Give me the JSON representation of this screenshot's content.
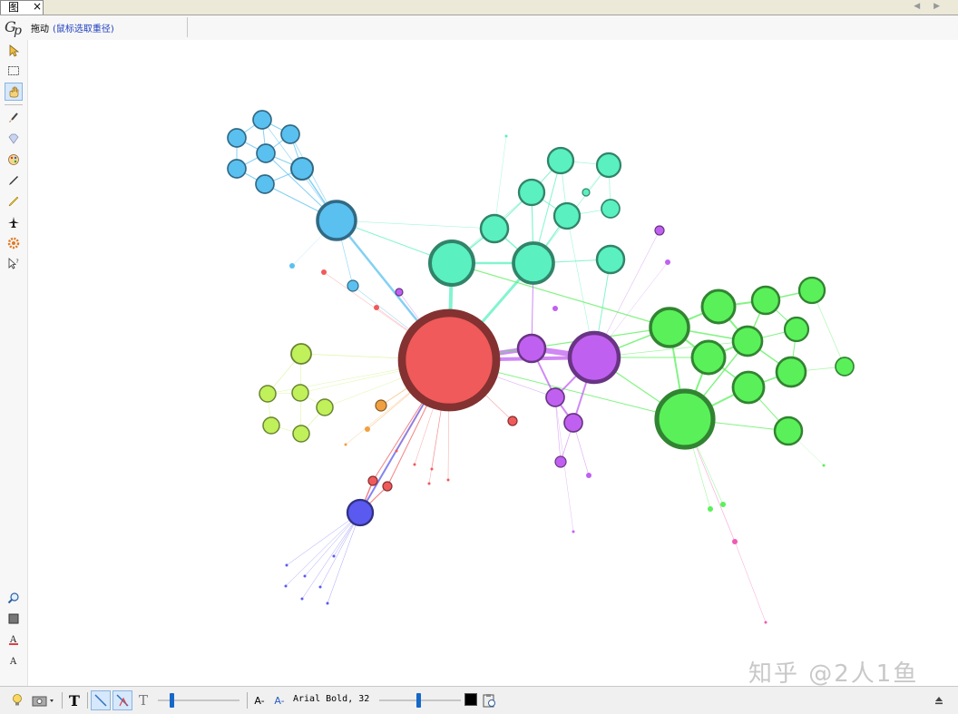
{
  "tab": {
    "label": "图",
    "close_symbol": "×"
  },
  "mode": {
    "label": "拖动",
    "hint": "(鼠标选取重径)"
  },
  "watermark": "知乎 @2人1鱼",
  "format_bar": {
    "text_tool_label": "T",
    "plain_text_label": "T",
    "font_decrease_label": "A-",
    "font_increase_label": "A-",
    "font_name_size": "Arial Bold, 32",
    "text_color": "#000000"
  },
  "graph": {
    "colors": {
      "red": "#f05a5a",
      "purple": "#c060f0",
      "teal": "#5af0c0",
      "green": "#5af05a",
      "blue": "#5ac0f0",
      "lime": "#c0f05a",
      "indigo": "#5a5af0",
      "orange": "#f0a040",
      "pink": "#f05ab4"
    }
  }
}
